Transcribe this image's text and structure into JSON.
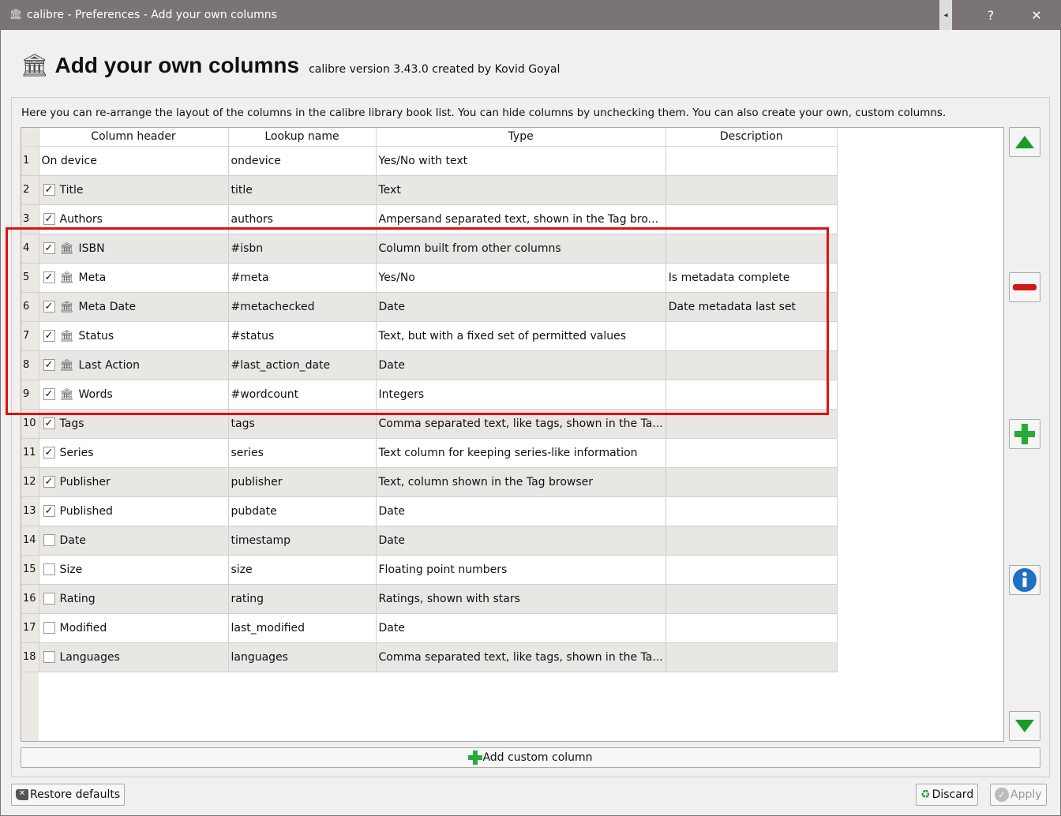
{
  "window": {
    "title": "calibre - Preferences - Add your own columns",
    "help": "?",
    "close": "✕"
  },
  "header": {
    "title": "Add your own columns",
    "version": "calibre version 3.43.0 created by Kovid Goyal"
  },
  "intro": "Here you can re-arrange the layout of the columns in the calibre library book list. You can hide columns by unchecking them. You can also create your own, custom columns.",
  "columns": [
    "Column header",
    "Lookup name",
    "Type",
    "Description"
  ],
  "rows": [
    {
      "n": "1",
      "checkbox": false,
      "hasCheckbox": false,
      "custom": false,
      "header": "On device",
      "lookup": "ondevice",
      "type": "Yes/No with text",
      "desc": ""
    },
    {
      "n": "2",
      "checkbox": true,
      "hasCheckbox": true,
      "custom": false,
      "header": "Title",
      "lookup": "title",
      "type": "Text",
      "desc": ""
    },
    {
      "n": "3",
      "checkbox": true,
      "hasCheckbox": true,
      "custom": false,
      "header": "Authors",
      "lookup": "authors",
      "type": "Ampersand separated text, shown in the Tag bro...",
      "desc": ""
    },
    {
      "n": "4",
      "checkbox": true,
      "hasCheckbox": true,
      "custom": true,
      "header": "ISBN",
      "lookup": "#isbn",
      "type": "Column built from other columns",
      "desc": ""
    },
    {
      "n": "5",
      "checkbox": true,
      "hasCheckbox": true,
      "custom": true,
      "header": "Meta",
      "lookup": "#meta",
      "type": "Yes/No",
      "desc": "Is metadata complete"
    },
    {
      "n": "6",
      "checkbox": true,
      "hasCheckbox": true,
      "custom": true,
      "header": "Meta Date",
      "lookup": "#metachecked",
      "type": "Date",
      "desc": "Date metadata last set"
    },
    {
      "n": "7",
      "checkbox": true,
      "hasCheckbox": true,
      "custom": true,
      "header": "Status",
      "lookup": "#status",
      "type": "Text, but with a fixed set of permitted values",
      "desc": ""
    },
    {
      "n": "8",
      "checkbox": true,
      "hasCheckbox": true,
      "custom": true,
      "header": "Last Action",
      "lookup": "#last_action_date",
      "type": "Date",
      "desc": ""
    },
    {
      "n": "9",
      "checkbox": true,
      "hasCheckbox": true,
      "custom": true,
      "header": "Words",
      "lookup": "#wordcount",
      "type": "Integers",
      "desc": ""
    },
    {
      "n": "10",
      "checkbox": true,
      "hasCheckbox": true,
      "custom": false,
      "header": "Tags",
      "lookup": "tags",
      "type": "Comma separated text, like tags, shown in the Ta...",
      "desc": ""
    },
    {
      "n": "11",
      "checkbox": true,
      "hasCheckbox": true,
      "custom": false,
      "header": "Series",
      "lookup": "series",
      "type": "Text column for keeping series-like information",
      "desc": ""
    },
    {
      "n": "12",
      "checkbox": true,
      "hasCheckbox": true,
      "custom": false,
      "header": "Publisher",
      "lookup": "publisher",
      "type": "Text, column shown in the Tag browser",
      "desc": ""
    },
    {
      "n": "13",
      "checkbox": true,
      "hasCheckbox": true,
      "custom": false,
      "header": "Published",
      "lookup": "pubdate",
      "type": "Date",
      "desc": ""
    },
    {
      "n": "14",
      "checkbox": false,
      "hasCheckbox": true,
      "custom": false,
      "header": "Date",
      "lookup": "timestamp",
      "type": "Date",
      "desc": ""
    },
    {
      "n": "15",
      "checkbox": false,
      "hasCheckbox": true,
      "custom": false,
      "header": "Size",
      "lookup": "size",
      "type": "Floating point numbers",
      "desc": ""
    },
    {
      "n": "16",
      "checkbox": false,
      "hasCheckbox": true,
      "custom": false,
      "header": "Rating",
      "lookup": "rating",
      "type": "Ratings, shown with stars",
      "desc": ""
    },
    {
      "n": "17",
      "checkbox": false,
      "hasCheckbox": true,
      "custom": false,
      "header": "Modified",
      "lookup": "last_modified",
      "type": "Date",
      "desc": ""
    },
    {
      "n": "18",
      "checkbox": false,
      "hasCheckbox": true,
      "custom": false,
      "header": "Languages",
      "lookup": "languages",
      "type": "Comma separated text, like tags, shown in the Ta...",
      "desc": ""
    }
  ],
  "buttons": {
    "add_custom": "Add custom column",
    "restore": "Restore defaults",
    "discard": "Discard",
    "apply": "Apply"
  }
}
